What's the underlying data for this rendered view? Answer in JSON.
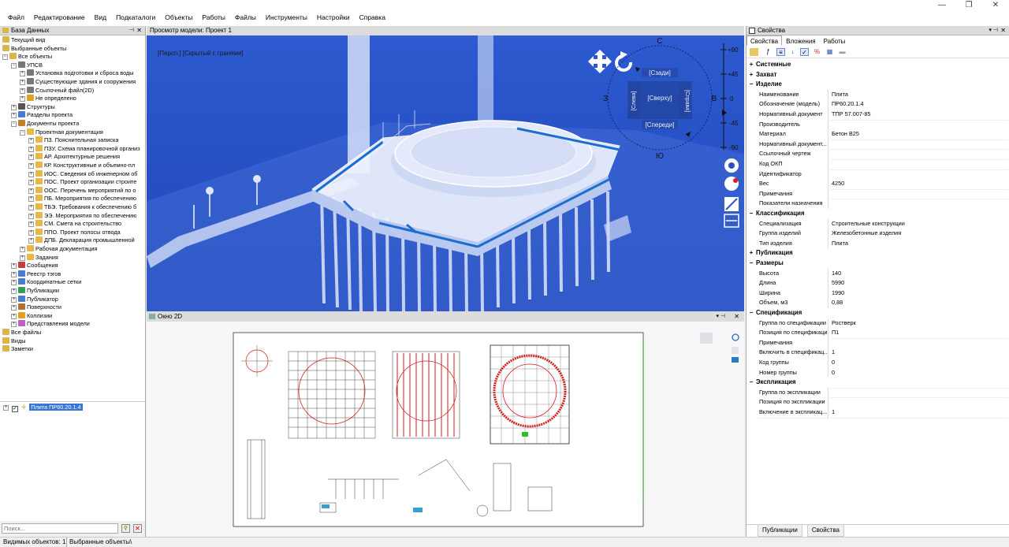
{
  "menu": [
    "Файл",
    "Редактирование",
    "Вид",
    "Подкаталоги",
    "Объекты",
    "Работы",
    "Файлы",
    "Инструменты",
    "Настройки",
    "Справка"
  ],
  "window_buttons": [
    "—",
    "❐",
    "✕"
  ],
  "left_panel": {
    "title": "База Данных",
    "tree": [
      {
        "label": "Текущий вид",
        "indent": 0,
        "exp": "",
        "color": "#d9b54a"
      },
      {
        "label": "Выбранные объекты",
        "indent": 0,
        "exp": "",
        "color": "#d9b54a"
      },
      {
        "label": "Все объекты",
        "indent": 0,
        "exp": "−",
        "color": "#d9b54a"
      },
      {
        "label": "УПСВ",
        "indent": 1,
        "exp": "−",
        "color": "#777"
      },
      {
        "label": "Установка подготовки и сброса воды",
        "indent": 2,
        "exp": "+",
        "color": "#777"
      },
      {
        "label": "Существующие здания и сооружения",
        "indent": 2,
        "exp": "+",
        "color": "#777"
      },
      {
        "label": "Ссылочный файл(2D)",
        "indent": 2,
        "exp": "+",
        "color": "#777"
      },
      {
        "label": "Не определено",
        "indent": 2,
        "exp": "+",
        "color": "#e0a020"
      },
      {
        "label": "Структуры",
        "indent": 1,
        "exp": "+",
        "color": "#555"
      },
      {
        "label": "Разделы проекта",
        "indent": 1,
        "exp": "+",
        "color": "#4a7bd0"
      },
      {
        "label": "Документы проекта",
        "indent": 1,
        "exp": "−",
        "color": "#c08030"
      },
      {
        "label": "Проектная документация",
        "indent": 2,
        "exp": "−",
        "color": "#e6b84a"
      },
      {
        "label": "ПЗ. Пояснительная записка",
        "indent": 3,
        "exp": "+",
        "color": "#e6b84a"
      },
      {
        "label": "ПЗУ. Схема планировочной организ",
        "indent": 3,
        "exp": "+",
        "color": "#e6b84a"
      },
      {
        "label": "АР. Архитектурные решения",
        "indent": 3,
        "exp": "+",
        "color": "#e6b84a"
      },
      {
        "label": "КР. Конструктивные и объемно-пл",
        "indent": 3,
        "exp": "+",
        "color": "#e6b84a"
      },
      {
        "label": "ИОС. Сведения об инженерном об",
        "indent": 3,
        "exp": "+",
        "color": "#e6b84a"
      },
      {
        "label": "ПОС. Проект организации строите",
        "indent": 3,
        "exp": "+",
        "color": "#e6b84a"
      },
      {
        "label": "ООС. Перечень мероприятий по о",
        "indent": 3,
        "exp": "+",
        "color": "#e6b84a"
      },
      {
        "label": "ПБ. Мероприятия по обеспечению",
        "indent": 3,
        "exp": "+",
        "color": "#e6b84a"
      },
      {
        "label": "ТБЭ. Требования к обеспечению б",
        "indent": 3,
        "exp": "+",
        "color": "#e6b84a"
      },
      {
        "label": "ЭЭ. Мероприятия по обеспечению",
        "indent": 3,
        "exp": "+",
        "color": "#e6b84a"
      },
      {
        "label": "СМ. Смета на строительство",
        "indent": 3,
        "exp": "+",
        "color": "#e6b84a"
      },
      {
        "label": "ППО. Проект полосы отвода",
        "indent": 3,
        "exp": "+",
        "color": "#e6b84a"
      },
      {
        "label": "ДПБ. Декларация промышленной",
        "indent": 3,
        "exp": "+",
        "color": "#e6b84a"
      },
      {
        "label": "Рабочая документация",
        "indent": 2,
        "exp": "+",
        "color": "#e6b84a"
      },
      {
        "label": "Задания",
        "indent": 2,
        "exp": "+",
        "color": "#e6b84a"
      },
      {
        "label": "Сообщения",
        "indent": 1,
        "exp": "+",
        "color": "#c04040"
      },
      {
        "label": "Реестр тэгов",
        "indent": 1,
        "exp": "+",
        "color": "#4a7bd0"
      },
      {
        "label": "Координатные сетки",
        "indent": 1,
        "exp": "+",
        "color": "#4a7bd0"
      },
      {
        "label": "Публикации",
        "indent": 1,
        "exp": "+",
        "color": "#3a9a5a"
      },
      {
        "label": "Публикатор",
        "indent": 1,
        "exp": "+",
        "color": "#4a7bd0"
      },
      {
        "label": "Поверхности",
        "indent": 1,
        "exp": "+",
        "color": "#b07030"
      },
      {
        "label": "Коллизии",
        "indent": 1,
        "exp": "+",
        "color": "#e0a020"
      },
      {
        "label": "Представления модели",
        "indent": 1,
        "exp": "+",
        "color": "#c060c0"
      },
      {
        "label": "Все файлы",
        "indent": 0,
        "exp": "",
        "color": "#d9b54a"
      },
      {
        "label": "Виды",
        "indent": 0,
        "exp": "",
        "color": "#d9b54a"
      },
      {
        "label": "Заметки",
        "indent": 0,
        "exp": "",
        "color": "#d9b54a"
      }
    ],
    "selected_item": "Плита ПР60.20.1.4",
    "search_placeholder": "Поиск..."
  },
  "view3d": {
    "title": "Просмотр модели: Проект 1",
    "mode_label": "[Персп.] [Скрытый с гранями]",
    "compass": {
      "n": "С",
      "s": "Ю",
      "e": "В",
      "w": "З"
    },
    "cube": {
      "top": "[Сзади]",
      "center": "[Сверху]",
      "bottom": "[Спереди]",
      "left": "[Слева]",
      "right": "[Справа]"
    },
    "scale": [
      "+90",
      "+45",
      "0",
      "-45",
      "-90"
    ]
  },
  "view2d": {
    "title": "Окно 2D"
  },
  "props": {
    "title": "Свойства",
    "tabs": [
      "Свойства",
      "Вложения",
      "Работы"
    ],
    "rows": [
      {
        "type": "cat",
        "pm": "+",
        "k": "Системные"
      },
      {
        "type": "cat",
        "pm": "+",
        "k": "Захват"
      },
      {
        "type": "cat",
        "pm": "−",
        "k": "Изделие"
      },
      {
        "type": "row",
        "k": "Наименование",
        "v": "Плита"
      },
      {
        "type": "row",
        "k": "Обозначение (модель)",
        "v": "ПР60.20.1.4"
      },
      {
        "type": "row",
        "k": "Нормативный документ",
        "v": "ТПР 57.007-85"
      },
      {
        "type": "row",
        "k": "Производитель",
        "v": ""
      },
      {
        "type": "row",
        "k": "Материал",
        "v": "Бетон В25"
      },
      {
        "type": "row",
        "k": "Нормативный документ...",
        "v": ""
      },
      {
        "type": "row",
        "k": "Ссылочный чертеж",
        "v": ""
      },
      {
        "type": "row",
        "k": "Код ОКП",
        "v": ""
      },
      {
        "type": "row",
        "k": "Идентификатор",
        "v": ""
      },
      {
        "type": "row",
        "k": "Вес",
        "v": "4250"
      },
      {
        "type": "row",
        "k": "Примечания",
        "v": ""
      },
      {
        "type": "row",
        "k": "Показатели назначения",
        "v": ""
      },
      {
        "type": "cat",
        "pm": "−",
        "k": "Классификация"
      },
      {
        "type": "row",
        "k": "Специализация",
        "v": "Строительные конструкции"
      },
      {
        "type": "row",
        "k": "Группа изделий",
        "v": "Железобетонные изделия"
      },
      {
        "type": "row",
        "k": "Тип изделия",
        "v": "Плита"
      },
      {
        "type": "cat",
        "pm": "+",
        "k": "Публикация"
      },
      {
        "type": "cat",
        "pm": "−",
        "k": "Размеры"
      },
      {
        "type": "row",
        "k": "Высота",
        "v": "140"
      },
      {
        "type": "row",
        "k": "Длина",
        "v": "5990"
      },
      {
        "type": "row",
        "k": "Ширина",
        "v": "1990"
      },
      {
        "type": "row",
        "k": "Объем, м3",
        "v": "0,88"
      },
      {
        "type": "cat",
        "pm": "−",
        "k": "Спецификация"
      },
      {
        "type": "row",
        "k": "Группа по спецификации",
        "v": "Ростверк"
      },
      {
        "type": "row",
        "k": "Позиция по спецификаци...",
        "v": "П1"
      },
      {
        "type": "row",
        "k": "Примечания",
        "v": ""
      },
      {
        "type": "row",
        "k": "Включить в спецификац...",
        "v": "1"
      },
      {
        "type": "row",
        "k": "Код группы",
        "v": "0"
      },
      {
        "type": "row",
        "k": "Номер группы",
        "v": "0"
      },
      {
        "type": "cat",
        "pm": "−",
        "k": "Экспликация"
      },
      {
        "type": "row",
        "k": "Группа по экспликации",
        "v": ""
      },
      {
        "type": "row",
        "k": "Позиция по экспликации",
        "v": ""
      },
      {
        "type": "row",
        "k": "Включение в экспликац...",
        "v": "1"
      }
    ],
    "bottom_tabs": [
      "Публикации",
      "Свойства"
    ]
  },
  "status": {
    "visible": "Видимых объектов: 1",
    "selected": "Выбранные объекты\\"
  }
}
